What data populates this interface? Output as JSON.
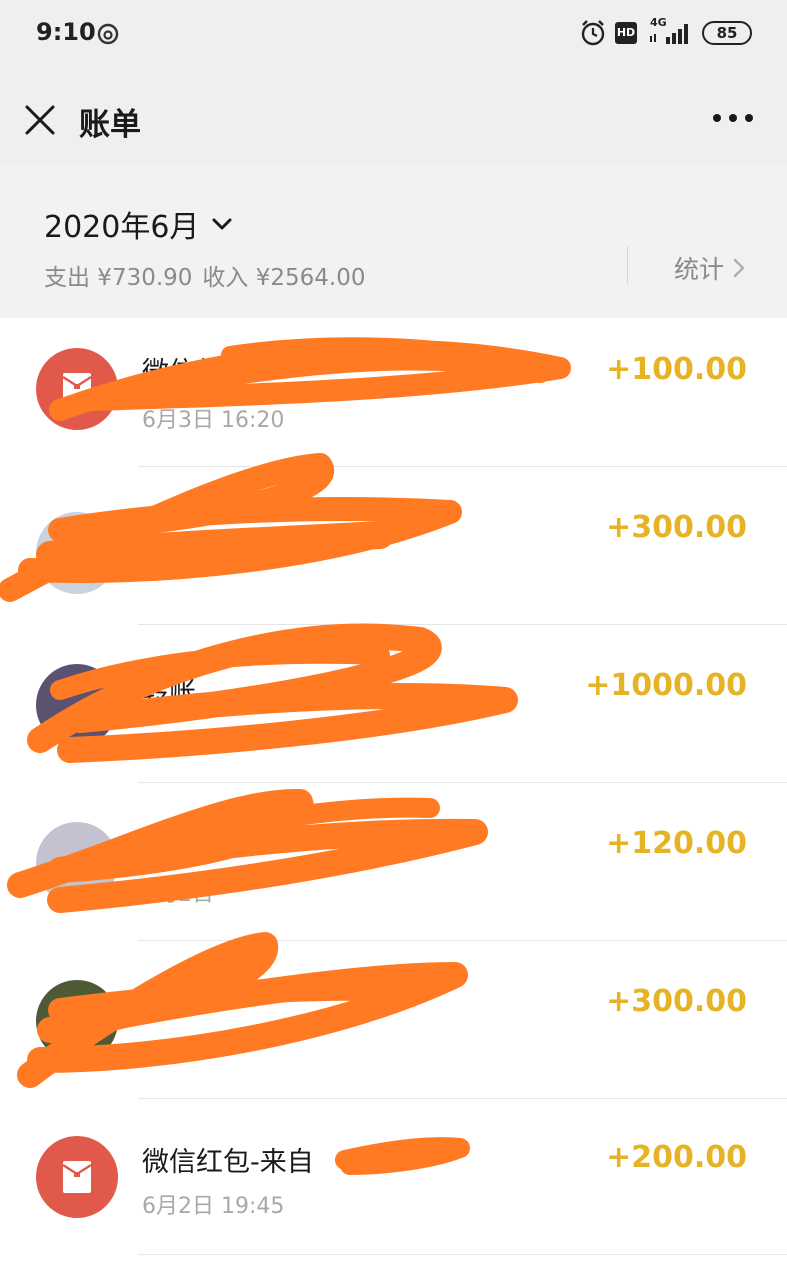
{
  "status_bar": {
    "time": "9:10",
    "battery": "85",
    "network": "4G",
    "hd_label": "HD"
  },
  "nav": {
    "title": "账单"
  },
  "summary": {
    "month": "2020年6月",
    "expense_label": "支出 ¥730.90",
    "income_label": "收入 ¥2564.00",
    "stats_label": "统计"
  },
  "transactions": [
    {
      "title": "微信红包",
      "time": "6月3日 16:20",
      "amount": "+100.00",
      "icon": "red-packet-icon"
    },
    {
      "title": "",
      "time": "",
      "amount": "+300.00",
      "icon": "avatar"
    },
    {
      "title": "转账",
      "time": "",
      "amount": "+1000.00",
      "icon": "avatar"
    },
    {
      "title": "转账",
      "time": "6月2日",
      "amount": "+120.00",
      "icon": "avatar"
    },
    {
      "title": "转账",
      "time": "",
      "amount": "+300.00",
      "icon": "avatar"
    },
    {
      "title": "微信红包-来自",
      "time": "6月2日 19:45",
      "amount": "+200.00",
      "icon": "red-packet-icon"
    }
  ],
  "colors": {
    "amount": "#e6b325",
    "red_packet": "#e1594a",
    "scribble": "#ff7a22"
  }
}
